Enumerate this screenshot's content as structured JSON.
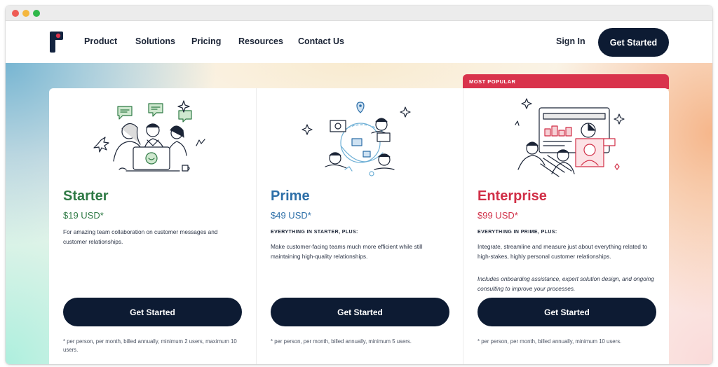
{
  "nav": {
    "links": [
      "Product",
      "Solutions",
      "Pricing",
      "Resources",
      "Contact Us"
    ],
    "sign_in": "Sign In",
    "cta": "Get Started"
  },
  "badge": "MOST POPULAR",
  "plans": [
    {
      "name": "Starter",
      "price": "$19 USD*",
      "color": "#2f7a45",
      "eyebrow": "",
      "description": "For amazing team collaboration on customer messages and customer relationships.",
      "note": "",
      "cta": "Get Started",
      "footnote": "* per person, per month, billed annually, minimum 2 users, maximum 10 users."
    },
    {
      "name": "Prime",
      "price": "$49 USD*",
      "color": "#2d6fa8",
      "eyebrow": "EVERYTHING IN STARTER, PLUS:",
      "description": "Make customer-facing teams much more efficient while still maintaining high-quality relationships.",
      "note": "",
      "cta": "Get Started",
      "footnote": "* per person, per month, billed annually, minimum 5 users."
    },
    {
      "name": "Enterprise",
      "price": "$99 USD*",
      "color": "#d12f47",
      "eyebrow": "EVERYTHING IN PRIME, PLUS:",
      "description": "Integrate, streamline and measure just about everything related to high-stakes, highly personal customer relationships.",
      "note": "Includes onboarding assistance, expert solution design, and ongoing consulting to improve your processes.",
      "cta": "Get Started",
      "footnote": "* per person, per month, billed annually, minimum 10 users."
    }
  ],
  "icons": [
    "logo-icon",
    "team-laptop-illustration",
    "collaboration-network-illustration",
    "analytics-dashboard-illustration"
  ]
}
